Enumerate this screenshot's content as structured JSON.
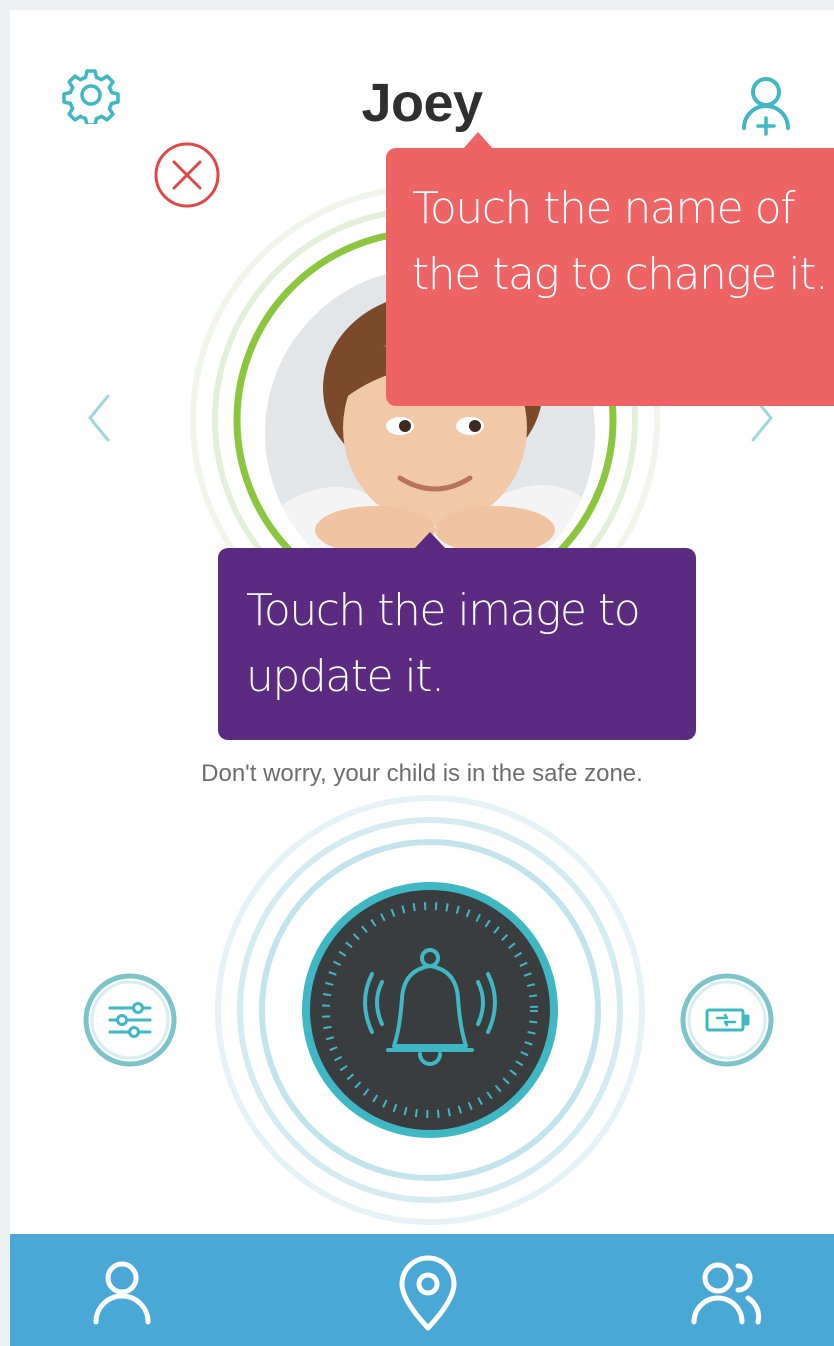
{
  "header": {
    "title": "Joey"
  },
  "tooltips": {
    "name_hint": "Touch the name of the tag to change it.",
    "image_hint": "Touch the image to update it."
  },
  "status": {
    "message": "Don't worry, your child is in the safe zone."
  },
  "colors": {
    "accent": "#3fb8c4",
    "safe_ring": "#8cc63f",
    "close_red": "#e04848",
    "tooltip_red": "#ee6464",
    "tooltip_purple": "#5b2b82",
    "nav_bar": "#4aa8d6",
    "alarm_dark": "#3a3d40"
  },
  "icons": {
    "settings": "gear-icon",
    "add_user": "user-plus-icon",
    "close": "close-icon",
    "prev": "chevron-left-icon",
    "next": "chevron-right-icon",
    "alarm": "bell-icon",
    "filters": "sliders-icon",
    "battery": "battery-icon",
    "nav_profile": "user-icon",
    "nav_location": "location-pin-icon",
    "nav_group": "users-icon"
  }
}
